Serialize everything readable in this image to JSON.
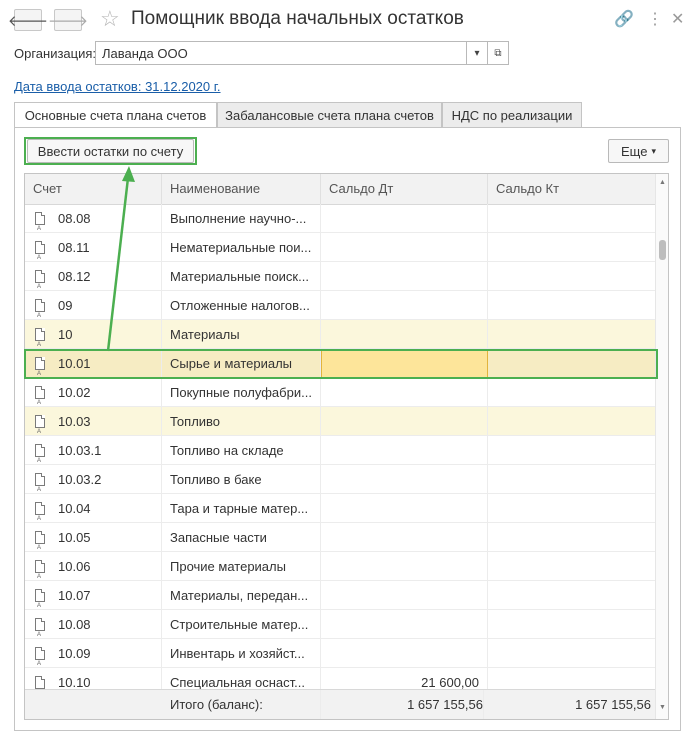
{
  "window": {
    "title": "Помощник ввода начальных остатков"
  },
  "org": {
    "label": "Организация:",
    "value": "Лаванда ООО"
  },
  "date_link": "Дата ввода остатков: 31.12.2020 г.",
  "tabs": [
    {
      "label": "Основные счета плана счетов",
      "active": true
    },
    {
      "label": "Забалансовые счета плана счетов",
      "active": false
    },
    {
      "label": "НДС по реализации",
      "active": false
    }
  ],
  "toolbar": {
    "enter_button": "Ввести остатки по счету",
    "more_button": "Еще"
  },
  "table": {
    "columns": [
      "Счет",
      "Наименование",
      "Сальдо Дт",
      "Сальдо Кт"
    ],
    "rows": [
      {
        "account": "08.08",
        "name": "Выполнение научно-...",
        "dt": "",
        "kt": ""
      },
      {
        "account": "08.11",
        "name": "Нематериальные пои...",
        "dt": "",
        "kt": ""
      },
      {
        "account": "08.12",
        "name": "Материальные поиск...",
        "dt": "",
        "kt": ""
      },
      {
        "account": "09",
        "name": "Отложенные налогов...",
        "dt": "",
        "kt": ""
      },
      {
        "account": "10",
        "name": "Материалы",
        "dt": "",
        "kt": ""
      },
      {
        "account": "10.01",
        "name": "Сырье и материалы",
        "dt": "",
        "kt": ""
      },
      {
        "account": "10.02",
        "name": "Покупные полуфабри...",
        "dt": "",
        "kt": ""
      },
      {
        "account": "10.03",
        "name": "Топливо",
        "dt": "",
        "kt": ""
      },
      {
        "account": "10.03.1",
        "name": "Топливо на складе",
        "dt": "",
        "kt": ""
      },
      {
        "account": "10.03.2",
        "name": "Топливо в баке",
        "dt": "",
        "kt": ""
      },
      {
        "account": "10.04",
        "name": "Тара и тарные матер...",
        "dt": "",
        "kt": ""
      },
      {
        "account": "10.05",
        "name": "Запасные части",
        "dt": "",
        "kt": ""
      },
      {
        "account": "10.06",
        "name": "Прочие материалы",
        "dt": "",
        "kt": ""
      },
      {
        "account": "10.07",
        "name": "Материалы, передан...",
        "dt": "",
        "kt": ""
      },
      {
        "account": "10.08",
        "name": "Строительные матер...",
        "dt": "",
        "kt": ""
      },
      {
        "account": "10.09",
        "name": "Инвентарь и хозяйст...",
        "dt": "",
        "kt": ""
      },
      {
        "account": "10.10",
        "name": "Специальная оснаст...",
        "dt": "21 600,00",
        "kt": ""
      }
    ],
    "footer": {
      "label": "Итого (баланс):",
      "dt": "1 657 155,56",
      "kt": "1 657 155,56"
    }
  },
  "colors": {
    "highlight": "#fbf7dc",
    "selected": "#f6ecc3",
    "active_cell": "#fde59a",
    "annotation": "#4caf50",
    "link": "#1a5ea8"
  }
}
